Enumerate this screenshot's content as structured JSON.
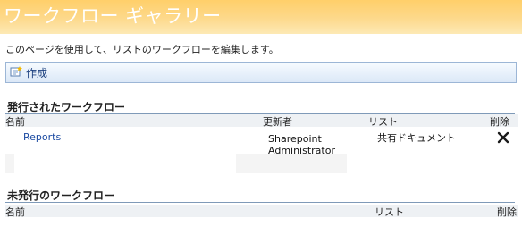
{
  "header": {
    "title": "ワークフロー ギャラリー"
  },
  "description": "このページを使用して、リストのワークフローを編集します。",
  "toolbar": {
    "create_label": "作成",
    "create_icon": "new-document-icon"
  },
  "published": {
    "heading": "発行されたワークフロー",
    "columns": {
      "name": "名前",
      "modified_by": "更新者",
      "list": "リスト",
      "delete": "削除"
    },
    "rows": [
      {
        "name": "Reports",
        "modified_by_line1": "Sharepoint",
        "modified_by_line2": "Administrator",
        "list": "共有ドキュメント",
        "delete_icon": "close-icon"
      }
    ]
  },
  "unpublished": {
    "heading": "未発行のワークフロー",
    "columns": {
      "name": "名前",
      "list": "リスト",
      "delete": "削除"
    }
  },
  "colors": {
    "title_band": "#ffcf6a",
    "link": "#1a49a1",
    "toolbar_border": "#9cb6d6"
  }
}
